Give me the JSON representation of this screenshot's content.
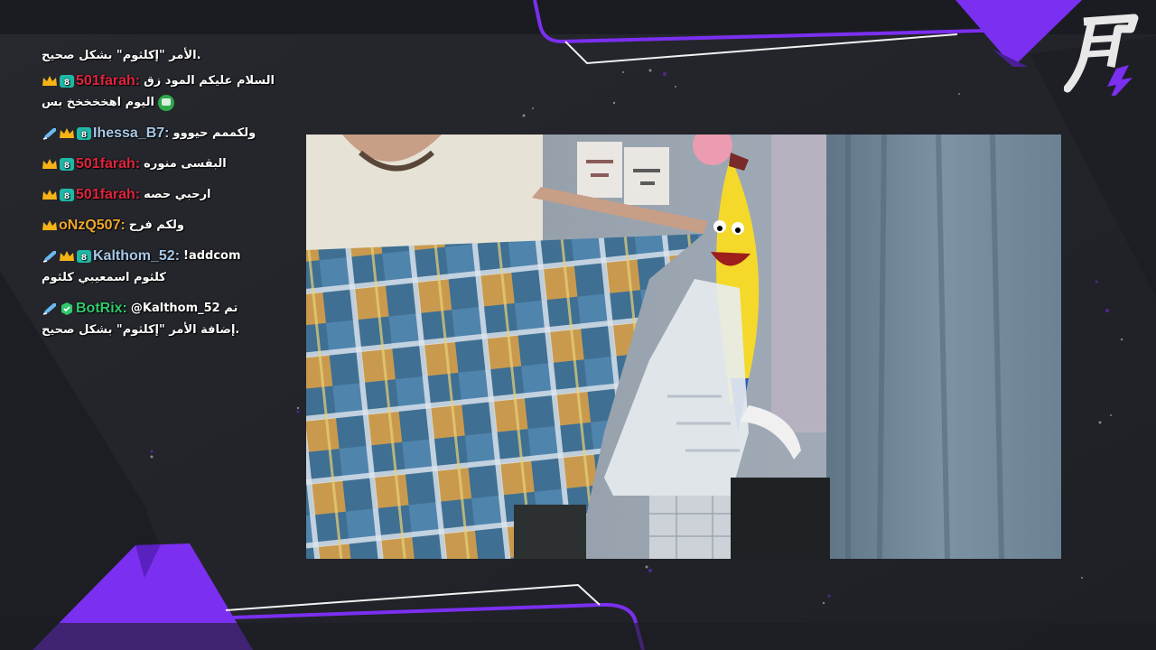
{
  "chat": {
    "messages": [
      {
        "user": "",
        "text": "الأمر \"إكلثوم\" بشكل صحيح.",
        "badges": []
      },
      {
        "user": "501farah:",
        "text": "السلام عليكم المود زق",
        "text2": "اليوم اهخخخخخ بس",
        "badges": [
          "crown-badge",
          "sub-badge"
        ],
        "user_color": "#e0253d"
      },
      {
        "user": "Ihessa_B7:",
        "text": "ولكممم حيووو",
        "badges": [
          "sword-badge",
          "crown-badge",
          "sub-badge"
        ],
        "user_color": "#a8c8e8"
      },
      {
        "user": "501farah:",
        "text": "البقسى منوره",
        "badges": [
          "crown-badge",
          "sub-badge"
        ],
        "user_color": "#e0253d"
      },
      {
        "user": "501farah:",
        "text": "ارحبي حصه",
        "badges": [
          "crown-badge",
          "sub-badge"
        ],
        "user_color": "#e0253d"
      },
      {
        "user": "oNzQ507:",
        "text": "ولكم فرح",
        "badges": [
          "crown-badge"
        ],
        "user_color": "#f0a72e"
      },
      {
        "user": "Kalthom_52:",
        "text": "!addcom",
        "text2": "كلثوم اسمعيبي كلثوم",
        "badges": [
          "sword-badge",
          "crown-badge",
          "sub-badge"
        ],
        "user_color": "#a8c8e8"
      },
      {
        "user": "BotRix:",
        "text": "@Kalthom_52 تم",
        "text2": "إضافة الأمر \"إكلثوم\" بشكل صحيح.",
        "badges": [
          "sword-badge",
          "bot-badge"
        ],
        "user_color": "#2ec96a"
      }
    ]
  },
  "colors": {
    "accent_purple": "#7b2ff0",
    "background": "#22242a",
    "frame_line": "#ffffff"
  },
  "logo": {
    "glyph": "月"
  }
}
